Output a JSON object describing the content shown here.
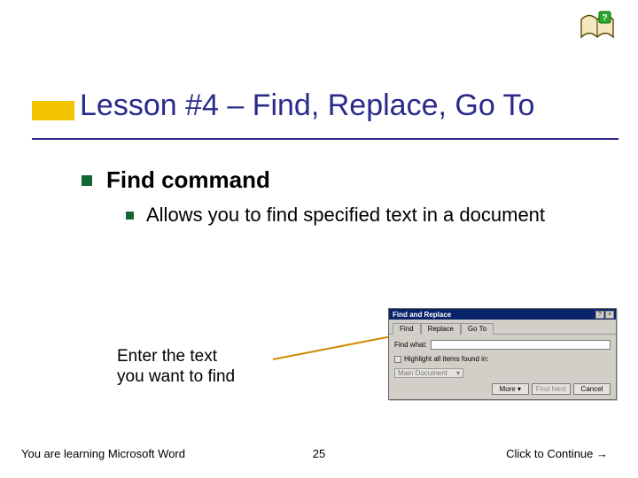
{
  "title": "Lesson #4 – Find, Replace, Go To",
  "bullets": {
    "l1": "Find command",
    "l2": "Allows you to find specified text in a document"
  },
  "callout": "Enter the text\nyou want to find",
  "dialog": {
    "title": "Find and Replace",
    "help_btn": "?",
    "close_btn": "×",
    "tabs": {
      "find": "Find",
      "replace": "Replace",
      "goto": "Go To"
    },
    "find_label": "Find what:",
    "highlight_label": "Highlight all items found in:",
    "dropdown_value": "Main Document",
    "dropdown_caret": "▾",
    "buttons": {
      "more": "More ▾",
      "find_next": "Find Next",
      "cancel": "Cancel"
    }
  },
  "footer": {
    "left": "You are learning Microsoft Word",
    "center": "25",
    "right": "Click to Continue →"
  }
}
